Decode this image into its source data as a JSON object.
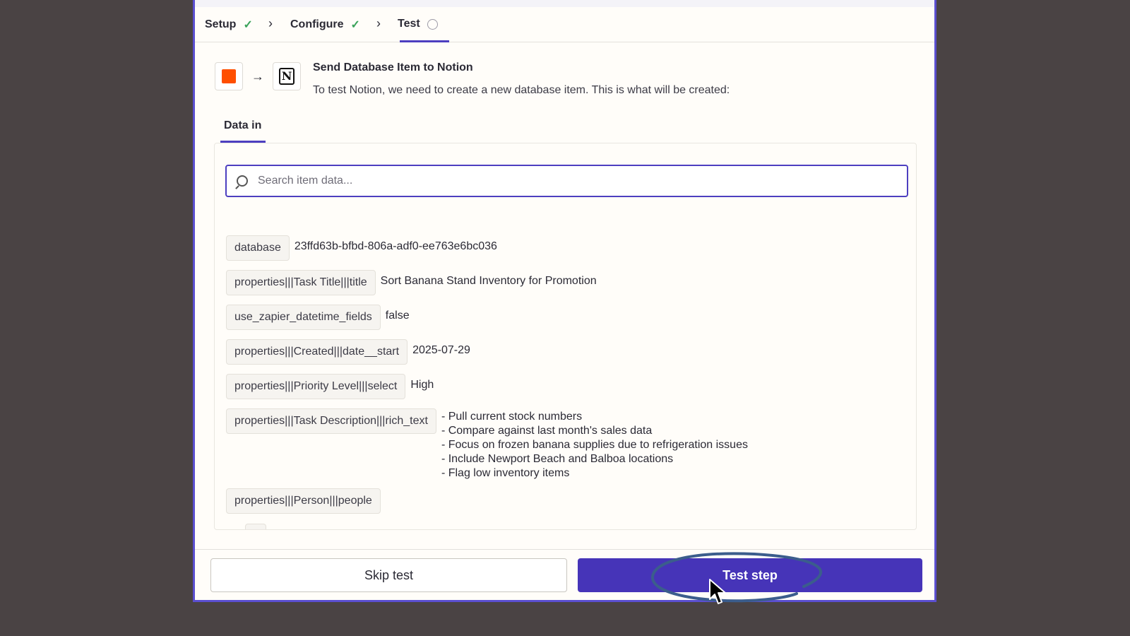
{
  "steps": [
    {
      "label": "Setup",
      "status": "complete"
    },
    {
      "label": "Configure",
      "status": "complete"
    },
    {
      "label": "Test",
      "status": "current"
    }
  ],
  "colors": {
    "accent": "#4d3fc0",
    "button": "#4634b8",
    "check": "#3aa35a",
    "trigger_app": "#ff4f00"
  },
  "header": {
    "title": "Send Database Item to Notion",
    "description": "To test Notion, we need to create a new database item. This is what will be created:"
  },
  "tabs": {
    "data_in": "Data in"
  },
  "search": {
    "placeholder": "Search item data..."
  },
  "data_rows": [
    {
      "key": "database",
      "value": "23ffd63b-bfbd-806a-adf0-ee763e6bc036"
    },
    {
      "key": "properties|||Task Title|||title",
      "value": "Sort Banana Stand Inventory for Promotion"
    },
    {
      "key": "use_zapier_datetime_fields",
      "value": "false"
    },
    {
      "key": "properties|||Created|||date__start",
      "value": "2025-07-29"
    },
    {
      "key": "properties|||Priority Level|||select",
      "value": "High"
    },
    {
      "key": "properties|||Task Description|||rich_text",
      "lines": [
        "- Pull current stock numbers",
        "- Compare against last month's sales data",
        "- Focus on frozen banana supplies due to refrigeration issues",
        "- Include Newport Beach and Balboa locations",
        "- Flag low inventory items"
      ]
    },
    {
      "key": "properties|||Person|||people",
      "value": ""
    }
  ],
  "buttons": {
    "skip": "Skip test",
    "test": "Test step"
  },
  "icons": {
    "step_complete": "check-icon",
    "step_current": "circle-icon",
    "search": "search-icon",
    "arrow": "arrow-right-icon",
    "notion": "notion-logo-icon"
  }
}
